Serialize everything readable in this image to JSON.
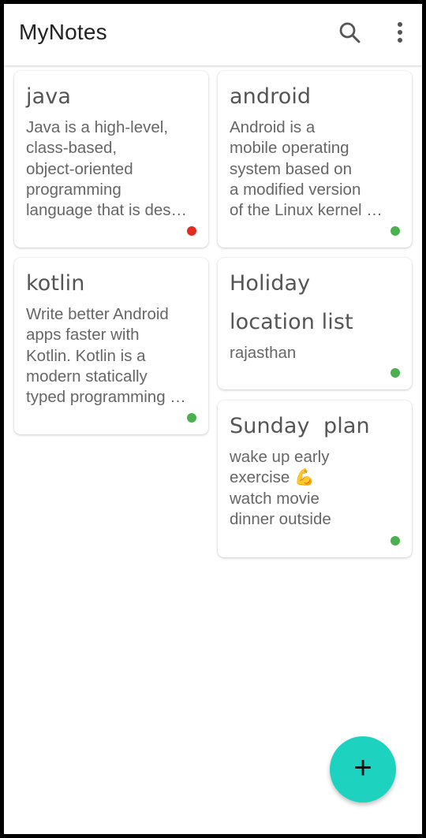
{
  "app": {
    "title": "MyNotes"
  },
  "toolbar": {
    "search_icon": "search-icon",
    "more_icon": "more-vertical-icon"
  },
  "notes": [
    {
      "title": "java",
      "body": "Java is a high-level,\nclass-based,\nobject-oriented\nprogramming\nlanguage that is des…",
      "status_color": "#e32b1f"
    },
    {
      "title": "android",
      "body": "Android is a\nmobile operating\nsystem based on\na modified version\nof the Linux kernel …",
      "status_color": "#4caf50"
    },
    {
      "title": "kotlin",
      "body": "Write better Android\napps faster with\nKotlin. Kotlin is a\nmodern statically\ntyped programming …",
      "status_color": "#4caf50"
    },
    {
      "title": "Holiday location list",
      "body": "rajasthan",
      "status_color": "#4caf50"
    },
    {
      "title": "Sunday  plan",
      "body": "wake up early\nexercise 💪\nwatch movie\ndinner outside",
      "status_color": "#4caf50"
    }
  ],
  "fab": {
    "label": "+",
    "color": "#1dd3c0"
  },
  "colors": {
    "accent": "#1dd3c0",
    "dot_red": "#e32b1f",
    "dot_green": "#4caf50"
  }
}
